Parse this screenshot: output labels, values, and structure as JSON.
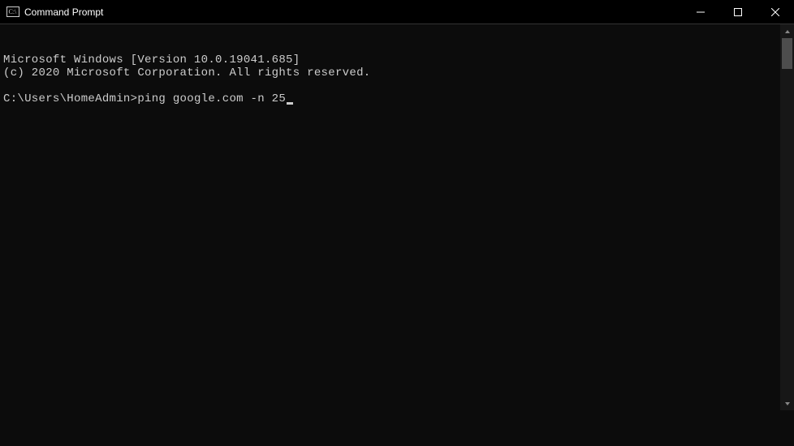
{
  "window": {
    "title": "Command Prompt"
  },
  "terminal": {
    "line1": "Microsoft Windows [Version 10.0.19041.685]",
    "line2": "(c) 2020 Microsoft Corporation. All rights reserved.",
    "blank": "",
    "prompt": "C:\\Users\\HomeAdmin>",
    "command": "ping google.com -n 25"
  }
}
